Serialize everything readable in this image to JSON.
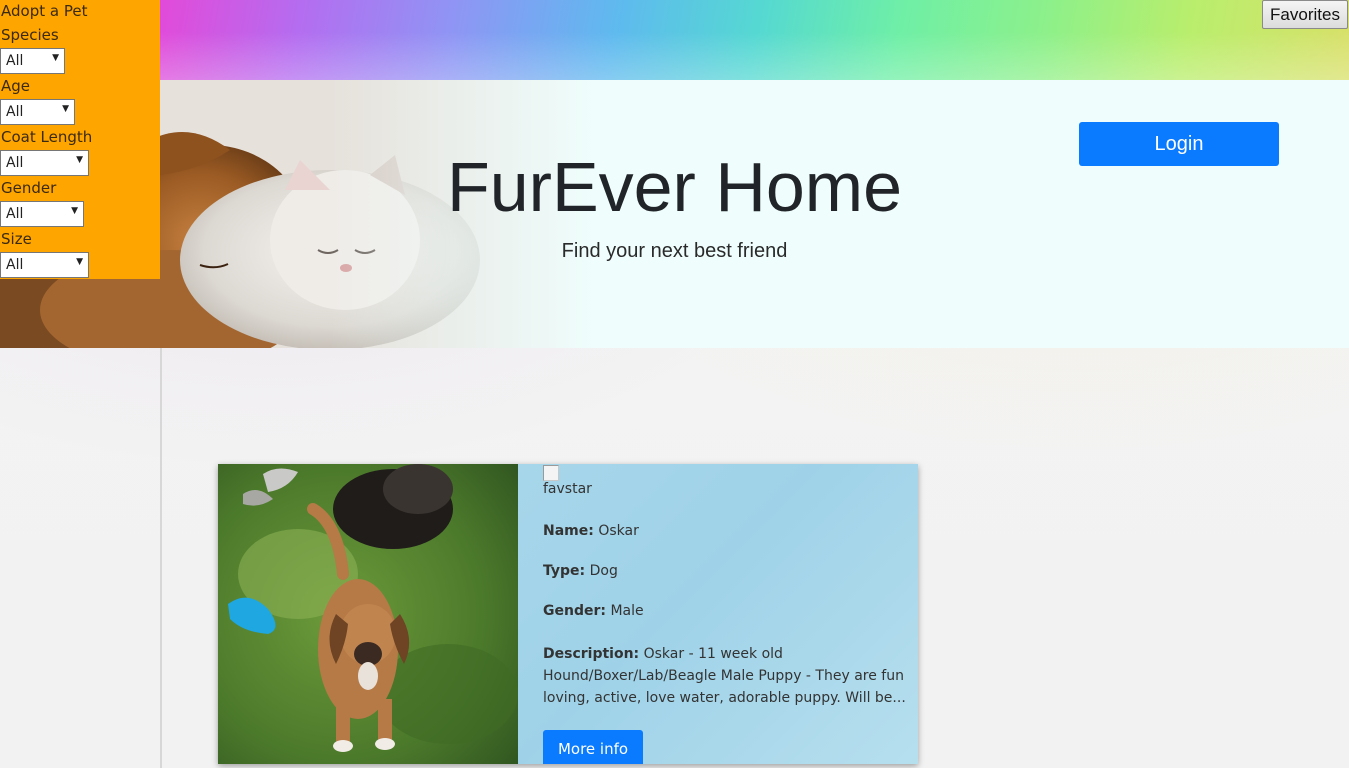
{
  "topbar": {
    "favorites_label": "Favorites"
  },
  "sidebar": {
    "title": "Adopt a Pet",
    "filters": [
      {
        "label": "Species",
        "value": "All"
      },
      {
        "label": "Age",
        "value": "All"
      },
      {
        "label": "Coat Length",
        "value": "All"
      },
      {
        "label": "Gender",
        "value": "All"
      },
      {
        "label": "Size",
        "value": "All"
      }
    ]
  },
  "hero": {
    "title": "FurEver Home",
    "subtitle": "Find your next best friend",
    "login_label": "Login"
  },
  "pet_card": {
    "favstar_alt": "favstar",
    "name_label": "Name:",
    "name": "Oskar",
    "type_label": "Type:",
    "type": "Dog",
    "gender_label": "Gender:",
    "gender": "Male",
    "description_label": "Description:",
    "description": "Oskar - 11 week old Hound/Boxer/Lab/Beagle Male Puppy - They are fun loving, active, love water, adorable puppy. Will be...",
    "more_info_label": "More info"
  },
  "colors": {
    "sidebar_bg": "#ffa500",
    "accent_blue": "#0a7bff",
    "hero_bg": "#effefd"
  }
}
